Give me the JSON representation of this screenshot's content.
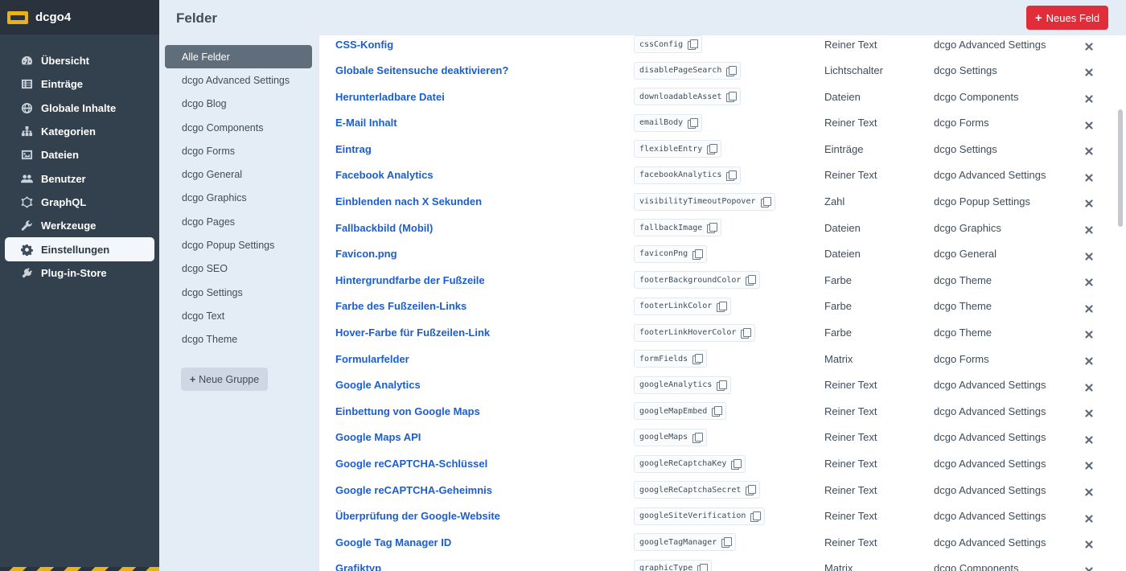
{
  "site": {
    "name": "dcgo4"
  },
  "nav": {
    "items": [
      {
        "label": "Übersicht",
        "icon": "gauge-icon"
      },
      {
        "label": "Einträge",
        "icon": "entries-icon"
      },
      {
        "label": "Globale Inhalte",
        "icon": "globe-icon"
      },
      {
        "label": "Kategorien",
        "icon": "sitemap-icon"
      },
      {
        "label": "Dateien",
        "icon": "image-icon"
      },
      {
        "label": "Benutzer",
        "icon": "users-icon"
      },
      {
        "label": "GraphQL",
        "icon": "graphql-icon"
      },
      {
        "label": "Werkzeuge",
        "icon": "wrench-icon"
      },
      {
        "label": "Einstellungen",
        "icon": "gear-icon",
        "active": true
      },
      {
        "label": "Plug-in-Store",
        "icon": "plug-icon"
      }
    ]
  },
  "header": {
    "title": "Felder",
    "new_field_label": "Neues Feld"
  },
  "groups": {
    "items": [
      "Alle Felder",
      "dcgo Advanced Settings",
      "dcgo Blog",
      "dcgo Components",
      "dcgo Forms",
      "dcgo General",
      "dcgo Graphics",
      "dcgo Pages",
      "dcgo Popup Settings",
      "dcgo SEO",
      "dcgo Settings",
      "dcgo Text",
      "dcgo Theme"
    ],
    "new_group_label": "Neue Gruppe"
  },
  "fields": [
    {
      "name": "CSS-Konfig",
      "handle": "cssConfig",
      "type": "Reiner Text",
      "group": "dcgo Advanced Settings"
    },
    {
      "name": "Globale Seitensuche deaktivieren?",
      "handle": "disablePageSearch",
      "type": "Lichtschalter",
      "group": "dcgo Settings"
    },
    {
      "name": "Herunterladbare Datei",
      "handle": "downloadableAsset",
      "type": "Dateien",
      "group": "dcgo Components"
    },
    {
      "name": "E-Mail Inhalt",
      "handle": "emailBody",
      "type": "Reiner Text",
      "group": "dcgo Forms"
    },
    {
      "name": "Eintrag",
      "handle": "flexibleEntry",
      "type": "Einträge",
      "group": "dcgo Settings"
    },
    {
      "name": "Facebook Analytics",
      "handle": "facebookAnalytics",
      "type": "Reiner Text",
      "group": "dcgo Advanced Settings"
    },
    {
      "name": "Einblenden nach X Sekunden",
      "handle": "visibilityTimeoutPopover",
      "type": "Zahl",
      "group": "dcgo Popup Settings"
    },
    {
      "name": "Fallbackbild (Mobil)",
      "handle": "fallbackImage",
      "type": "Dateien",
      "group": "dcgo Graphics"
    },
    {
      "name": "Favicon.png",
      "handle": "faviconPng",
      "type": "Dateien",
      "group": "dcgo General"
    },
    {
      "name": "Hintergrundfarbe der Fußzeile",
      "handle": "footerBackgroundColor",
      "type": "Farbe",
      "group": "dcgo Theme"
    },
    {
      "name": "Farbe des Fußzeilen-Links",
      "handle": "footerLinkColor",
      "type": "Farbe",
      "group": "dcgo Theme"
    },
    {
      "name": "Hover-Farbe für Fußzeilen-Link",
      "handle": "footerLinkHoverColor",
      "type": "Farbe",
      "group": "dcgo Theme"
    },
    {
      "name": "Formularfelder",
      "handle": "formFields",
      "type": "Matrix",
      "group": "dcgo Forms"
    },
    {
      "name": "Google Analytics",
      "handle": "googleAnalytics",
      "type": "Reiner Text",
      "group": "dcgo Advanced Settings"
    },
    {
      "name": "Einbettung von Google Maps",
      "handle": "googleMapEmbed",
      "type": "Reiner Text",
      "group": "dcgo Advanced Settings"
    },
    {
      "name": "Google Maps API",
      "handle": "googleMaps",
      "type": "Reiner Text",
      "group": "dcgo Advanced Settings"
    },
    {
      "name": "Google reCAPTCHA-Schlüssel",
      "handle": "googleReCaptchaKey",
      "type": "Reiner Text",
      "group": "dcgo Advanced Settings"
    },
    {
      "name": "Google reCAPTCHA-Geheimnis",
      "handle": "googleReCaptchaSecret",
      "type": "Reiner Text",
      "group": "dcgo Advanced Settings"
    },
    {
      "name": "Überprüfung der Google-Website",
      "handle": "googleSiteVerification",
      "type": "Reiner Text",
      "group": "dcgo Advanced Settings"
    },
    {
      "name": "Google Tag Manager ID",
      "handle": "googleTagManager",
      "type": "Reiner Text",
      "group": "dcgo Advanced Settings"
    },
    {
      "name": "Grafiktyp",
      "handle": "graphicType",
      "type": "Matrix",
      "group": "dcgo Components"
    }
  ],
  "colors": {
    "accent": "#e12d39",
    "link": "#1b5ed0",
    "sidebar": "#33404d"
  }
}
